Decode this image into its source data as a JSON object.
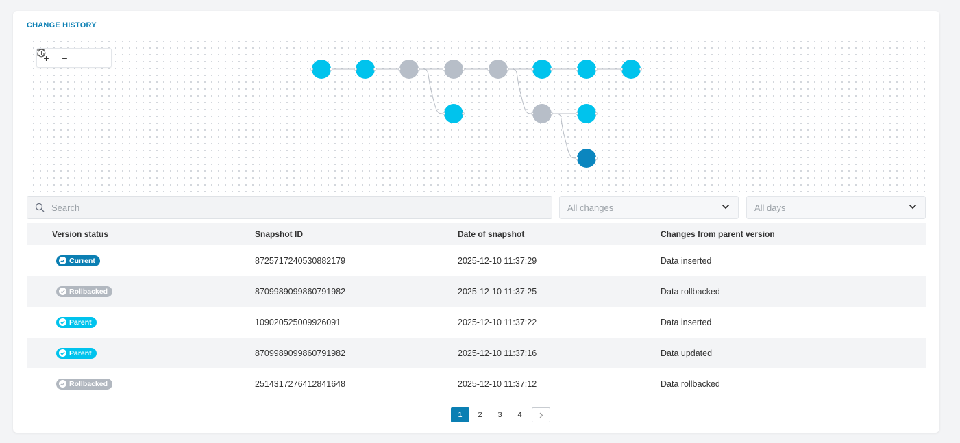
{
  "section": {
    "title": "CHANGE HISTORY"
  },
  "zoom": [
    {
      "name": "zoom-in-icon",
      "glyph": "+"
    },
    {
      "name": "zoom-out-icon",
      "glyph": "−"
    },
    {
      "name": "fit-view-icon",
      "glyph": "⛶"
    },
    {
      "name": "center-icon",
      "glyph": "⊕"
    }
  ],
  "graph": {
    "colors": {
      "active": "#00c3ed",
      "inactive": "#b7bec8",
      "current": "#0b86bf",
      "edge": "#b9bec6"
    }
  },
  "filters": {
    "search_placeholder": "Search",
    "changes_placeholder": "All changes",
    "days_placeholder": "All days"
  },
  "table": {
    "headers": [
      "Version status",
      "Snapshot ID",
      "Date of snapshot",
      "Changes from parent version"
    ],
    "rows": [
      {
        "status": "Current",
        "status_color": "#0b7fb3",
        "id": "8725717240530882179",
        "date": "2025-12-10 11:37:29",
        "change": "Data inserted"
      },
      {
        "status": "Rollbacked",
        "status_color": "#b2b8c0",
        "id": "8709989099860791982",
        "date": "2025-12-10 11:37:25",
        "change": "Data rollbacked"
      },
      {
        "status": "Parent",
        "status_color": "#00c3ed",
        "id": "109020525009926091",
        "date": "2025-12-10 11:37:22",
        "change": "Data inserted"
      },
      {
        "status": "Parent",
        "status_color": "#00c3ed",
        "id": "8709989099860791982",
        "date": "2025-12-10 11:37:16",
        "change": "Data updated"
      },
      {
        "status": "Rollbacked",
        "status_color": "#b2b8c0",
        "id": "2514317276412841648",
        "date": "2025-12-10 11:37:12",
        "change": "Data rollbacked"
      }
    ]
  },
  "pagination": {
    "pages": [
      "1",
      "2",
      "3",
      "4"
    ],
    "current": "1"
  }
}
